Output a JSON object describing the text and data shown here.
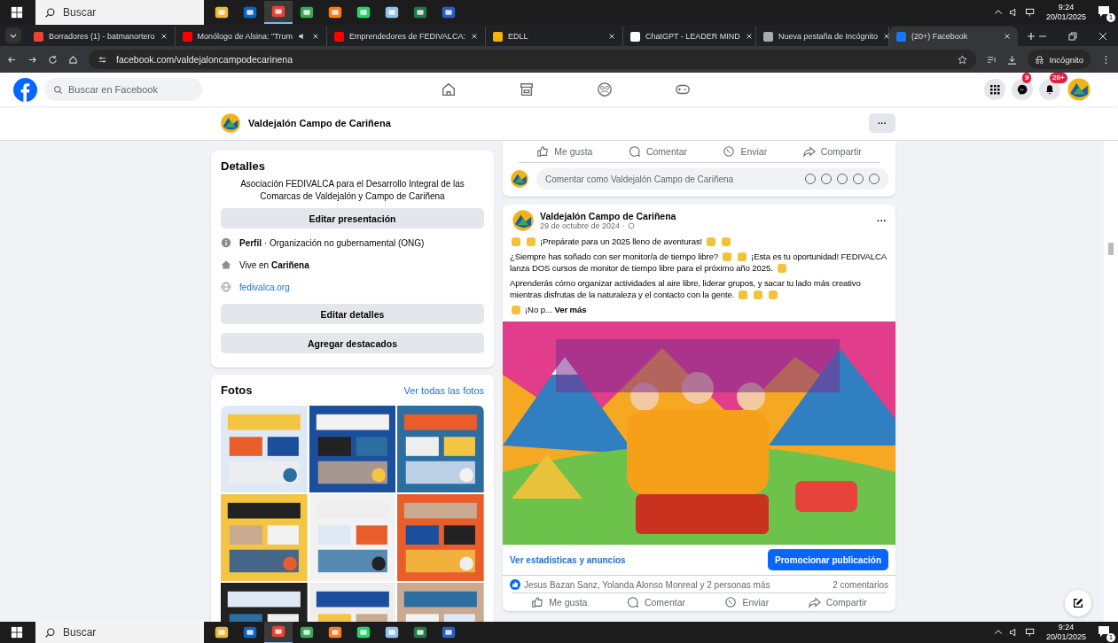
{
  "taskbar_top": {
    "search_placeholder": "Buscar",
    "apps": [
      {
        "kind": "folder"
      },
      {
        "kind": "mail"
      },
      {
        "kind": "browser",
        "selected": true
      },
      {
        "kind": "books"
      },
      {
        "kind": "firefox"
      },
      {
        "kind": "chat"
      },
      {
        "kind": "notes"
      },
      {
        "kind": "sheet"
      },
      {
        "kind": "doc"
      }
    ],
    "time": "9:24",
    "date": "20/01/2025",
    "notifications": "1"
  },
  "browser": {
    "tabs": [
      {
        "title": "Borradores (1) - batmanortero",
        "kind": "gmail",
        "audio": false,
        "selected": false
      },
      {
        "title": "Monólogo de Alsina: \"Trum",
        "kind": "video",
        "audio": true,
        "selected": false
      },
      {
        "title": "Emprendedores de FEDIVALCA:",
        "kind": "video",
        "audio": false,
        "selected": false
      },
      {
        "title": "EDLL",
        "kind": "flag",
        "audio": false,
        "selected": false
      },
      {
        "title": "ChatGPT - LEADER MIND",
        "kind": "chatgpt",
        "audio": false,
        "selected": false
      },
      {
        "title": "Nueva pestaña de Incógnito",
        "kind": "incognito",
        "audio": false,
        "selected": false
      },
      {
        "title": "(20+) Facebook",
        "kind": "facebook",
        "audio": false,
        "selected": true
      }
    ],
    "address": "facebook.com/valdejaloncampodecarinena",
    "incognito_label": "Incógnito"
  },
  "fb_header": {
    "search_placeholder": "Buscar en Facebook",
    "nav": [
      {
        "kind": "home"
      },
      {
        "kind": "store"
      },
      {
        "kind": "groups"
      },
      {
        "kind": "gaming"
      }
    ],
    "messenger_badge": "9",
    "notifications_badge": "20+"
  },
  "page_bar": {
    "name": "Valdejalón Campo de Cariñena",
    "more": "···"
  },
  "details": {
    "title": "Detalles",
    "description": "Asociación FEDIVALCA para el Desarrollo Integral de las Comarcas de Valdejalón y Campo de Cariñena",
    "intro_button": "Editar presentación",
    "items": [
      {
        "kind": "info",
        "text": "**Perfil** · Organización no gubernamental (ONG)"
      },
      {
        "kind": "home",
        "text": "Vive en **Cariñena**"
      },
      {
        "kind": "link",
        "text": "fedivalca.org"
      }
    ],
    "buttons": [
      "Editar detalles",
      "Agregar destacados"
    ]
  },
  "photos": {
    "title": "Fotos",
    "link": "Ver todas las fotos",
    "items": [
      {
        "kind": "picture"
      },
      {
        "kind": "picture"
      },
      {
        "kind": "picture"
      },
      {
        "kind": "picture"
      },
      {
        "kind": "picture"
      },
      {
        "kind": "picture"
      },
      {
        "kind": "picture"
      },
      {
        "kind": "picture"
      },
      {
        "kind": "picture"
      }
    ]
  },
  "previous_post": {
    "actions": [
      "Me gusta",
      "Comentar",
      "Enviar",
      "Compartir"
    ],
    "comment_placeholder": "Comentar como Valdejalón Campo de Cariñena"
  },
  "post": {
    "author": "Valdejalón Campo de Cariñena",
    "date": "29 de octubre de 2024 ·",
    "more": "···",
    "paragraphs": [
      [
        [
          {
            "kind": "emoji"
          },
          {
            "kind": "emoji"
          },
          {
            "kind": "text",
            "text": "¡Prepárate para un 2025 lleno de aventuras!"
          },
          {
            "kind": "emoji"
          },
          {
            "kind": "emoji"
          }
        ]
      ],
      [
        [
          {
            "kind": "text",
            "text": "¿Siempre has soñado con ser monitor/a de tiempo libre?"
          },
          {
            "kind": "emoji"
          },
          {
            "kind": "emoji"
          },
          {
            "kind": "text",
            "text": "¡Esta es tu oportunidad! FEDIVALCA"
          }
        ],
        [
          {
            "kind": "text",
            "text": "lanza DOS cursos de monitor de tiempo libre para el próximo año 2025."
          },
          {
            "kind": "emoji"
          }
        ]
      ],
      [
        [
          {
            "kind": "text",
            "text": "Aprenderás cómo organizar actividades al aire libre, liderar grupos, y sacar tu lado más creativo"
          }
        ],
        [
          {
            "kind": "text",
            "text": "mientras disfrutas de la naturaleza y el contacto con la gente."
          },
          {
            "kind": "emoji"
          },
          {
            "kind": "emoji"
          },
          {
            "kind": "emoji"
          }
        ]
      ],
      [
        [
          {
            "kind": "emoji"
          },
          {
            "kind": "text",
            "text": "¡No p..."
          },
          {
            "kind": "more",
            "text": "Ver más"
          }
        ]
      ]
    ],
    "image": {
      "kind": "picture"
    },
    "stats_link": "Ver estadísticas y anuncios",
    "promote_button": "Promocionar publicación",
    "reactions": "Jesus Bazan Sanz, Yolanda Alonso Monreal y 2 personas más",
    "comments": "2 comentarios",
    "actions": [
      "Me gusta",
      "Comentar",
      "Enviar",
      "Compartir"
    ]
  },
  "taskbar_bottom": {
    "search_placeholder": "Buscar",
    "apps": [
      {
        "kind": "folder"
      },
      {
        "kind": "mail"
      },
      {
        "kind": "browser",
        "selected": true
      },
      {
        "kind": "books"
      },
      {
        "kind": "firefox"
      },
      {
        "kind": "chat"
      },
      {
        "kind": "notes"
      },
      {
        "kind": "sheet"
      },
      {
        "kind": "doc"
      }
    ],
    "time": "9:24",
    "date": "20/01/2025",
    "notifications": "1"
  }
}
